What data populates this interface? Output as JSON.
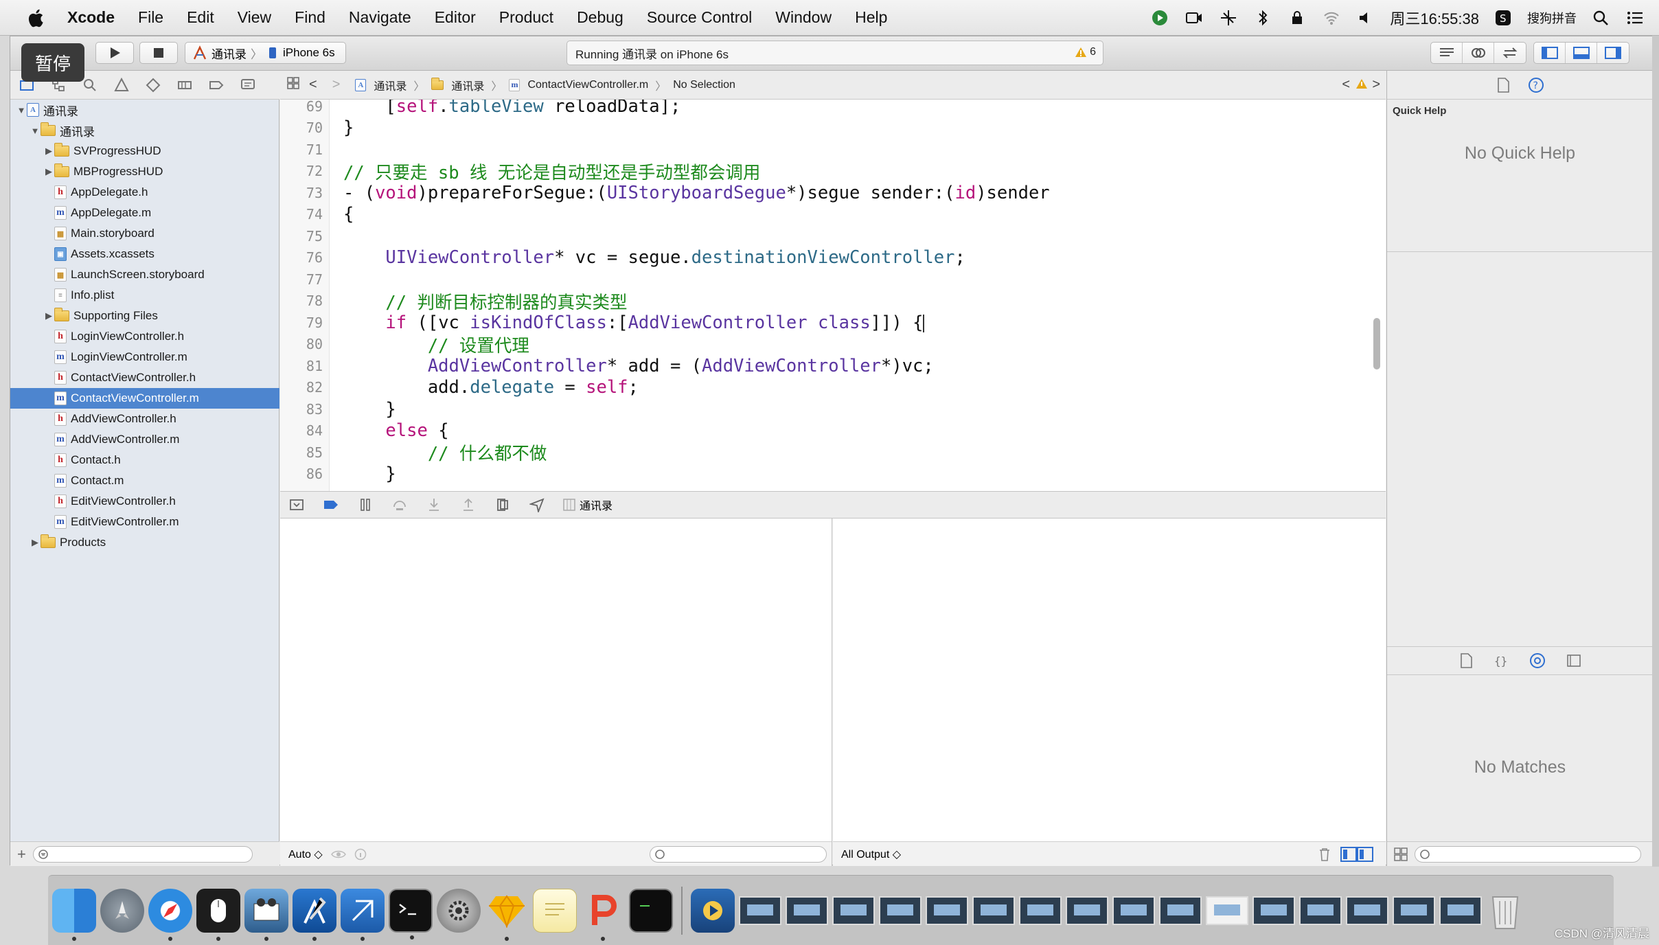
{
  "menubar": {
    "app": "Xcode",
    "items": [
      "File",
      "Edit",
      "View",
      "Find",
      "Navigate",
      "Editor",
      "Product",
      "Debug",
      "Source Control",
      "Window",
      "Help"
    ],
    "clock": "周三16:55:38",
    "ime": "搜狗拼音"
  },
  "toolbar": {
    "pause_badge": "暂停",
    "scheme_name": "通讯录",
    "device": "iPhone 6s",
    "activity": "Running 通讯录 on iPhone 6s",
    "warning_count": "6"
  },
  "navigator": {
    "items": [
      {
        "label": "通讯录",
        "kind": "proj",
        "indent": 0,
        "tri": "▼"
      },
      {
        "label": "通讯录",
        "kind": "folder",
        "indent": 1,
        "tri": "▼"
      },
      {
        "label": "SVProgressHUD",
        "kind": "folder",
        "indent": 2,
        "tri": "▶"
      },
      {
        "label": "MBProgressHUD",
        "kind": "folder",
        "indent": 2,
        "tri": "▶"
      },
      {
        "label": "AppDelegate.h",
        "kind": "h",
        "indent": 2,
        "tri": ""
      },
      {
        "label": "AppDelegate.m",
        "kind": "m",
        "indent": 2,
        "tri": ""
      },
      {
        "label": "Main.storyboard",
        "kind": "sb",
        "indent": 2,
        "tri": ""
      },
      {
        "label": "Assets.xcassets",
        "kind": "xca",
        "indent": 2,
        "tri": ""
      },
      {
        "label": "LaunchScreen.storyboard",
        "kind": "sb",
        "indent": 2,
        "tri": ""
      },
      {
        "label": "Info.plist",
        "kind": "pl",
        "indent": 2,
        "tri": ""
      },
      {
        "label": "Supporting Files",
        "kind": "folder",
        "indent": 2,
        "tri": "▶"
      },
      {
        "label": "LoginViewController.h",
        "kind": "h",
        "indent": 2,
        "tri": ""
      },
      {
        "label": "LoginViewController.m",
        "kind": "m",
        "indent": 2,
        "tri": ""
      },
      {
        "label": "ContactViewController.h",
        "kind": "h",
        "indent": 2,
        "tri": ""
      },
      {
        "label": "ContactViewController.m",
        "kind": "m",
        "indent": 2,
        "tri": "",
        "selected": true
      },
      {
        "label": "AddViewController.h",
        "kind": "h",
        "indent": 2,
        "tri": ""
      },
      {
        "label": "AddViewController.m",
        "kind": "m",
        "indent": 2,
        "tri": ""
      },
      {
        "label": "Contact.h",
        "kind": "h",
        "indent": 2,
        "tri": ""
      },
      {
        "label": "Contact.m",
        "kind": "m",
        "indent": 2,
        "tri": ""
      },
      {
        "label": "EditViewController.h",
        "kind": "h",
        "indent": 2,
        "tri": ""
      },
      {
        "label": "EditViewController.m",
        "kind": "m",
        "indent": 2,
        "tri": ""
      },
      {
        "label": "Products",
        "kind": "folder",
        "indent": 1,
        "tri": "▶"
      }
    ]
  },
  "jumpbar": {
    "project": "通讯录",
    "group": "通讯录",
    "file": "ContactViewController.m",
    "selection": "No Selection"
  },
  "code": {
    "lines": [
      {
        "n": "69",
        "segs": [
          [
            "",
            "    ["
          ],
          [
            "k",
            "self"
          ],
          [
            "",
            "."
          ],
          [
            "p",
            "tableView"
          ],
          [
            "",
            " reloadData];"
          ]
        ]
      },
      {
        "n": "70",
        "segs": [
          [
            "",
            "}"
          ]
        ]
      },
      {
        "n": "71",
        "segs": []
      },
      {
        "n": "72",
        "segs": [
          [
            "c",
            "// 只要走 sb 线 无论是自动型还是手动型都会调用"
          ]
        ]
      },
      {
        "n": "73",
        "segs": [
          [
            "",
            "- ("
          ],
          [
            "k",
            "void"
          ],
          [
            "",
            ")prepareForSegue:("
          ],
          [
            "t",
            "UIStoryboardSegue"
          ],
          [
            "",
            "*)segue sender:("
          ],
          [
            "k",
            "id"
          ],
          [
            "",
            ")sender"
          ]
        ]
      },
      {
        "n": "74",
        "segs": [
          [
            "",
            "{"
          ]
        ]
      },
      {
        "n": "75",
        "segs": []
      },
      {
        "n": "76",
        "segs": [
          [
            "",
            "    "
          ],
          [
            "t",
            "UIViewController"
          ],
          [
            "",
            "* vc = segue."
          ],
          [
            "p",
            "destinationViewController"
          ],
          [
            "",
            ";"
          ]
        ]
      },
      {
        "n": "77",
        "segs": []
      },
      {
        "n": "78",
        "segs": [
          [
            "",
            "    "
          ],
          [
            "c",
            "// 判断目标控制器的真实类型"
          ]
        ]
      },
      {
        "n": "79",
        "segs": [
          [
            "",
            "    "
          ],
          [
            "k",
            "if"
          ],
          [
            "",
            " ([vc "
          ],
          [
            "t",
            "isKindOfClass"
          ],
          [
            "",
            ":["
          ],
          [
            "t",
            "AddViewController"
          ],
          [
            "",
            " "
          ],
          [
            "t",
            "class"
          ],
          [
            "",
            "]]) {"
          ]
        ]
      },
      {
        "n": "80",
        "segs": [
          [
            "",
            "        "
          ],
          [
            "c",
            "// 设置代理"
          ]
        ]
      },
      {
        "n": "81",
        "segs": [
          [
            "",
            "        "
          ],
          [
            "t",
            "AddViewController"
          ],
          [
            "",
            "* add = ("
          ],
          [
            "t",
            "AddViewController"
          ],
          [
            "",
            "*)vc;"
          ]
        ]
      },
      {
        "n": "82",
        "segs": [
          [
            "",
            "        add."
          ],
          [
            "p",
            "delegate"
          ],
          [
            "",
            " = "
          ],
          [
            "k",
            "self"
          ],
          [
            "",
            ";"
          ]
        ]
      },
      {
        "n": "83",
        "segs": [
          [
            "",
            "    }"
          ]
        ]
      },
      {
        "n": "84",
        "segs": [
          [
            "",
            "    "
          ],
          [
            "k",
            "else"
          ],
          [
            "",
            " {"
          ]
        ]
      },
      {
        "n": "85",
        "segs": [
          [
            "",
            "        "
          ],
          [
            "c",
            "// 什么都不做"
          ]
        ]
      },
      {
        "n": "86",
        "segs": [
          [
            "",
            "    }"
          ]
        ]
      }
    ]
  },
  "debug": {
    "process": "通讯录",
    "vars_scope": "Auto ◇",
    "console_scope": "All Output ◇"
  },
  "utilities": {
    "quick_help_title": "Quick Help",
    "quick_help_msg": "No Quick Help",
    "library_msg": "No Matches"
  },
  "watermark": "CSDN @清风清晨",
  "colors": {
    "selection": "#4d85cf",
    "keyword": "#b5137a",
    "type": "#5a35a0",
    "property": "#2d6a87",
    "comment": "#1d8a1d",
    "annotation_arrow": "#e8392a"
  }
}
